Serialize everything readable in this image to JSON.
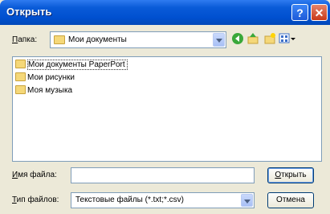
{
  "window": {
    "title": "Открыть",
    "help_label": "?",
    "close_label": "✕"
  },
  "lookin": {
    "label": "Папка:",
    "value": "Мои документы",
    "icons": [
      "back-icon",
      "up-folder-icon",
      "new-folder-icon",
      "views-menu-icon"
    ]
  },
  "files": [
    {
      "name": "Мои документы PaperPort",
      "icon": "folder-icon",
      "selected": true
    },
    {
      "name": "Мои рисунки",
      "icon": "pictures-folder-icon",
      "selected": false
    },
    {
      "name": "Моя музыка",
      "icon": "music-folder-icon",
      "selected": false
    }
  ],
  "filename": {
    "label": "Имя файла:",
    "value": ""
  },
  "filetype": {
    "label": "Тип файлов:",
    "value": "Текстовые файлы (*.txt;*.csv)"
  },
  "buttons": {
    "open": "Открыть",
    "cancel": "Отмена"
  }
}
